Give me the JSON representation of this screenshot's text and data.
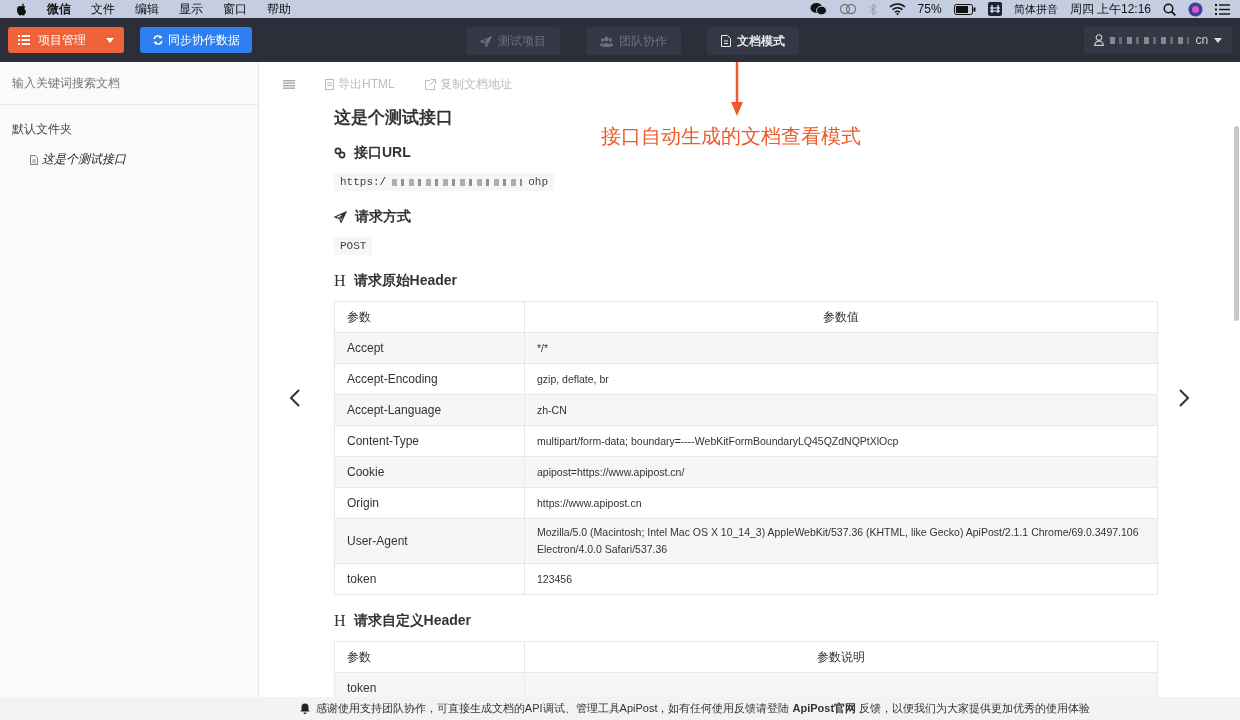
{
  "menubar": {
    "items": [
      "微信",
      "文件",
      "编辑",
      "显示",
      "窗口",
      "帮助"
    ],
    "battery": "75%",
    "input_method": "简体拼音",
    "clock": "周四 上午12:16"
  },
  "toolbar": {
    "project_button": "项目管理",
    "sync_button": "同步协作数据",
    "tabs": [
      {
        "label": "测试项目",
        "selected": false
      },
      {
        "label": "团队协作",
        "selected": false
      },
      {
        "label": "文档模式",
        "selected": true
      }
    ],
    "user": "cn"
  },
  "sidebar": {
    "search": {
      "placeholder": "输入关键词搜索文档"
    },
    "folders": [
      {
        "name": "默认文件夹",
        "children": [
          {
            "name": "这是个测试接口",
            "selected": true
          }
        ]
      }
    ]
  },
  "doc_toolbar": {
    "actions": [
      "导出HTML",
      "复制文档地址"
    ]
  },
  "annotation": "接口自动生成的文档查看模式",
  "doc": {
    "title": "这是个测试接口",
    "sections": [
      {
        "kind": "url",
        "heading": "接口URL",
        "url_start": "https:/",
        "url_end": "ohp"
      },
      {
        "kind": "method",
        "heading": "请求方式",
        "value": "POST"
      },
      {
        "kind": "table",
        "icon": "H",
        "heading": "请求原始Header",
        "columns": [
          "参数",
          "参数值"
        ],
        "rows": [
          [
            "Accept",
            "*/*"
          ],
          [
            "Accept-Encoding",
            "gzip, deflate, br"
          ],
          [
            "Accept-Language",
            "zh-CN"
          ],
          [
            "Content-Type",
            "multipart/form-data; boundary=----WebKitFormBoundaryLQ45QZdNQPtXlOcp"
          ],
          [
            "Cookie",
            "apipost=https://www.apipost.cn/"
          ],
          [
            "Origin",
            "https://www.apipost.cn"
          ],
          [
            "User-Agent",
            "Mozilla/5.0 (Macintosh; Intel Mac OS X 10_14_3) AppleWebKit/537.36 (KHTML, like Gecko) ApiPost/2.1.1 Chrome/69.0.3497.106 Electron/4.0.0 Safari/537.36"
          ],
          [
            "token",
            "123456"
          ]
        ]
      },
      {
        "kind": "table",
        "icon": "H",
        "heading": "请求自定义Header",
        "columns": [
          "参数",
          "参数说明"
        ],
        "rows": [
          [
            "token",
            ""
          ]
        ]
      }
    ]
  },
  "footer": {
    "text_before": "感谢使用支持团队协作，可直接生成文档的API调试、管理工具ApiPost，如有任何使用反馈请登陆 ",
    "link": "ApiPost官网",
    "text_after": " 反馈，以便我们为大家提供更加优秀的使用体验"
  }
}
